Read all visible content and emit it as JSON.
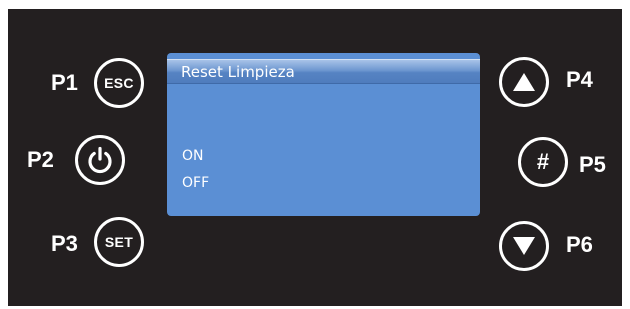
{
  "buttons": {
    "p1": {
      "label": "P1",
      "face": "ESC"
    },
    "p2": {
      "label": "P2",
      "icon": "power-icon"
    },
    "p3": {
      "label": "P3",
      "face": "SET"
    },
    "p4": {
      "label": "P4",
      "icon": "arrow-up-icon"
    },
    "p5": {
      "label": "P5",
      "face": "#"
    },
    "p6": {
      "label": "P6",
      "icon": "arrow-down-icon"
    }
  },
  "display": {
    "title": "Reset Limpieza",
    "options": [
      "ON",
      "OFF"
    ]
  },
  "colors": {
    "panel": "#231f20",
    "screen": "#5b8fd4",
    "text": "#ffffff"
  }
}
